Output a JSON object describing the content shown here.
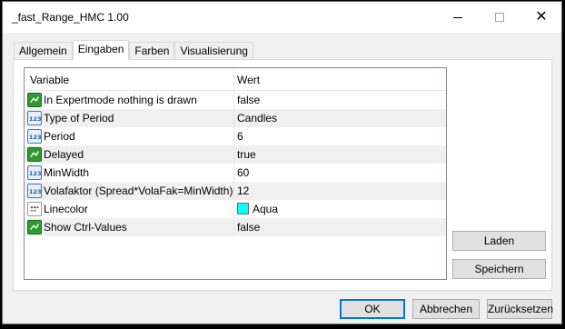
{
  "window": {
    "title": "_fast_Range_HMC 1.00"
  },
  "tabs": [
    {
      "label": "Allgemein"
    },
    {
      "label": "Eingaben"
    },
    {
      "label": "Farben"
    },
    {
      "label": "Visualisierung"
    }
  ],
  "active_tab": "Eingaben",
  "grid": {
    "header": {
      "variable": "Variable",
      "value": "Wert"
    },
    "rows": [
      {
        "name": "In Expertmode nothing is drawn",
        "value": "false",
        "icon": "bool-icon"
      },
      {
        "name": "Type of Period",
        "value": "Candles",
        "icon": "number-icon"
      },
      {
        "name": "Period",
        "value": "6",
        "icon": "number-icon"
      },
      {
        "name": "Delayed",
        "value": "true",
        "icon": "bool-icon"
      },
      {
        "name": "MinWidth",
        "value": "60",
        "icon": "number-icon"
      },
      {
        "name": "Volafaktor (Spread*VolaFak=MinWidth)",
        "value": "12",
        "icon": "number-icon"
      },
      {
        "name": "Linecolor",
        "value": "Aqua",
        "icon": "color-icon",
        "swatch": "#00ffff"
      },
      {
        "name": "Show Ctrl-Values",
        "value": "false",
        "icon": "bool-icon"
      }
    ]
  },
  "side_buttons": {
    "load": "Laden",
    "save": "Speichern"
  },
  "footer": {
    "ok": "OK",
    "cancel": "Abbrechen",
    "reset": "Zurücksetzen"
  },
  "colors": {
    "accent": "#0078d7",
    "bool_icon": "#2e9a2e",
    "number_icon": "#3a7ac0"
  }
}
